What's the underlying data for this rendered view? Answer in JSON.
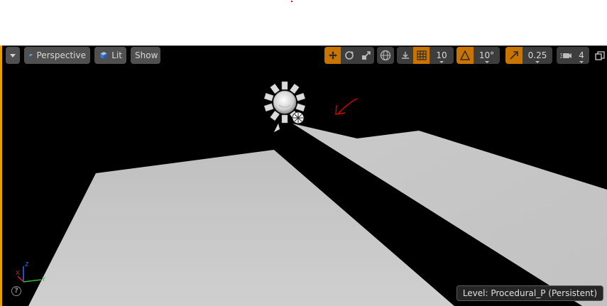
{
  "toolbar": {
    "viewmode_label": "Perspective",
    "lighting_label": "Lit",
    "show_label": "Show",
    "grid_snap_value": "10",
    "rotation_snap_value": "10°",
    "scale_snap_value": "0.25",
    "camera_speed_value": "4"
  },
  "status": {
    "level_label": "Level:  Procedural_P (Persistent)"
  },
  "icons": {
    "menu": "chevron-down-icon",
    "perspective": "perspective-cube-icon",
    "lit": "lit-sphere-icon",
    "translate": "translate-icon",
    "rotate": "rotate-icon",
    "scale": "scale-icon",
    "world_local": "globe-icon",
    "surface_snap": "surface-snap-icon",
    "grid_snap": "grid-icon",
    "rotation_snap": "angle-icon",
    "scale_snap": "scale-arrow-icon",
    "camera_speed": "camera-icon",
    "maximize": "maximize-icon",
    "help": "help-icon"
  },
  "colors": {
    "accent_orange": "#c97400",
    "viewport_bg": "#000000",
    "floor": "#c8c8c8",
    "annotation_red": "#e00000"
  }
}
